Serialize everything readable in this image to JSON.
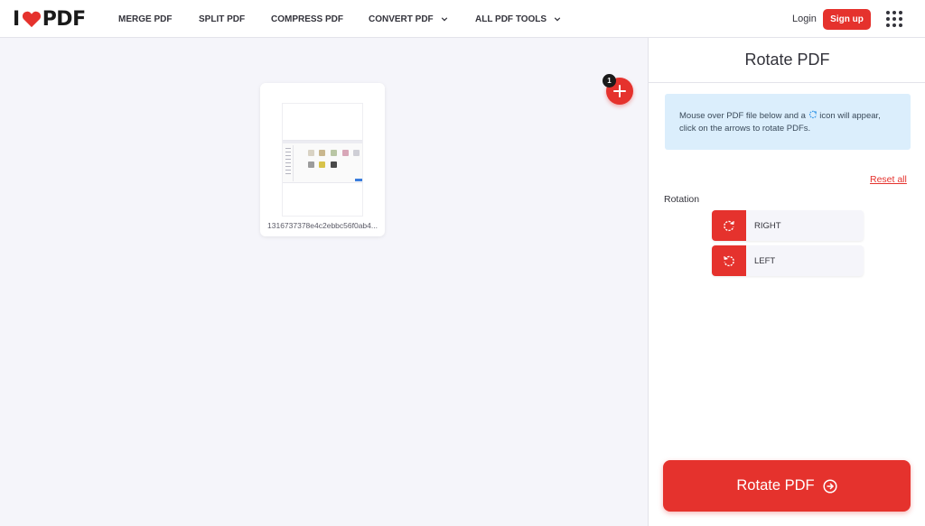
{
  "header": {
    "logo_left": "I",
    "logo_right": "PDF",
    "nav": {
      "merge": "MERGE PDF",
      "split": "SPLIT PDF",
      "compress": "COMPRESS PDF",
      "convert": "CONVERT PDF",
      "all_tools": "ALL PDF TOOLS"
    },
    "login": "Login",
    "signup": "Sign up",
    "apps_icon": "grid-icon"
  },
  "workspace": {
    "file": {
      "name": "1316737378e4c2ebbc56f0ab4..."
    },
    "file_count": "1",
    "add_icon": "plus-icon"
  },
  "sidebar": {
    "title": "Rotate PDF",
    "info_before": "Mouse over PDF file below and a",
    "info_after": "icon will appear, click on the arrows to rotate PDFs.",
    "reset_all": "Reset all",
    "rotation_label": "Rotation",
    "right_label": "RIGHT",
    "left_label": "LEFT",
    "process_label": "Rotate PDF"
  },
  "colors": {
    "brand": "#e5322d",
    "info_bg": "#dbeefc",
    "canvas_bg": "#f5f5fa"
  }
}
